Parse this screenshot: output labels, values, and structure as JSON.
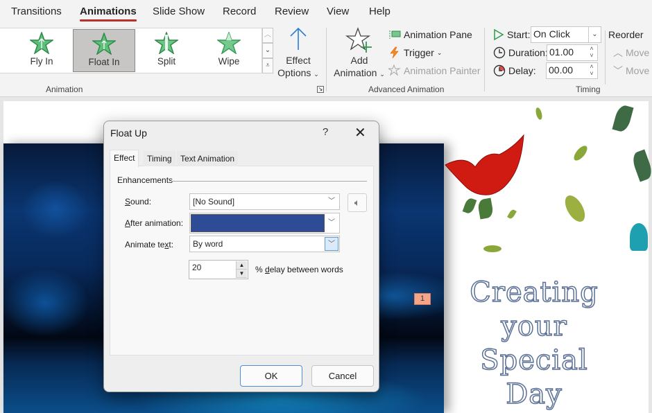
{
  "ribbon_tabs": [
    {
      "label": "Transitions",
      "active": false
    },
    {
      "label": "Animations",
      "active": true
    },
    {
      "label": "Slide Show",
      "active": false
    },
    {
      "label": "Record",
      "active": false
    },
    {
      "label": "Review",
      "active": false
    },
    {
      "label": "View",
      "active": false
    },
    {
      "label": "Help",
      "active": false
    }
  ],
  "animation_group": {
    "label": "Animation",
    "gallery": [
      {
        "label": "Fly In",
        "icon": "fly-in-star-icon",
        "selected": false
      },
      {
        "label": "Float In",
        "icon": "float-in-star-icon",
        "selected": true
      },
      {
        "label": "Split",
        "icon": "split-star-icon",
        "selected": false
      },
      {
        "label": "Wipe",
        "icon": "wipe-star-icon",
        "selected": false
      }
    ],
    "effect_options": {
      "line1": "Effect",
      "line2": "Options",
      "icon": "up-arrow-icon"
    }
  },
  "advanced_animation_group": {
    "label": "Advanced Animation",
    "add_animation": {
      "line1": "Add",
      "line2": "Animation",
      "icon": "star-plus-icon"
    },
    "animation_pane": "Animation Pane",
    "trigger": "Trigger",
    "animation_painter": "Animation Painter"
  },
  "timing_group": {
    "label": "Timing",
    "start_label": "Start:",
    "start_value": "On Click",
    "duration_label": "Duration:",
    "duration_value": "01.00",
    "delay_label": "Delay:",
    "delay_value": "00.00",
    "reorder_label": "Reorder",
    "move_earlier": "Move",
    "move_later": "Move"
  },
  "slide": {
    "animation_tag": "1",
    "title_lines": [
      "Creating",
      "your",
      "Special",
      "Day"
    ],
    "colors": {
      "title_outline": "#5a7094",
      "tag_bg": "#f4a58a"
    }
  },
  "dialog": {
    "title": "Float Up",
    "help": "?",
    "close": "✕",
    "tabs": [
      {
        "label": "Effect",
        "active": true
      },
      {
        "label": "Timing",
        "active": false
      },
      {
        "label": "Text Animation",
        "active": false
      }
    ],
    "section": "Enhancements",
    "sound_label_u": "S",
    "sound_label_rest": "ound:",
    "sound_value": "[No Sound]",
    "after_label_u": "A",
    "after_label_rest": "fter animation:",
    "after_color": "#2e4b95",
    "animate_text_label_a": "Animate te",
    "animate_text_label_u": "x",
    "animate_text_label_b": "t:",
    "animate_text_value": "By word",
    "delay_value": "20",
    "delay_label_a": "% ",
    "delay_label_u": "d",
    "delay_label_b": "elay between words",
    "ok": "OK",
    "cancel": "Cancel"
  }
}
